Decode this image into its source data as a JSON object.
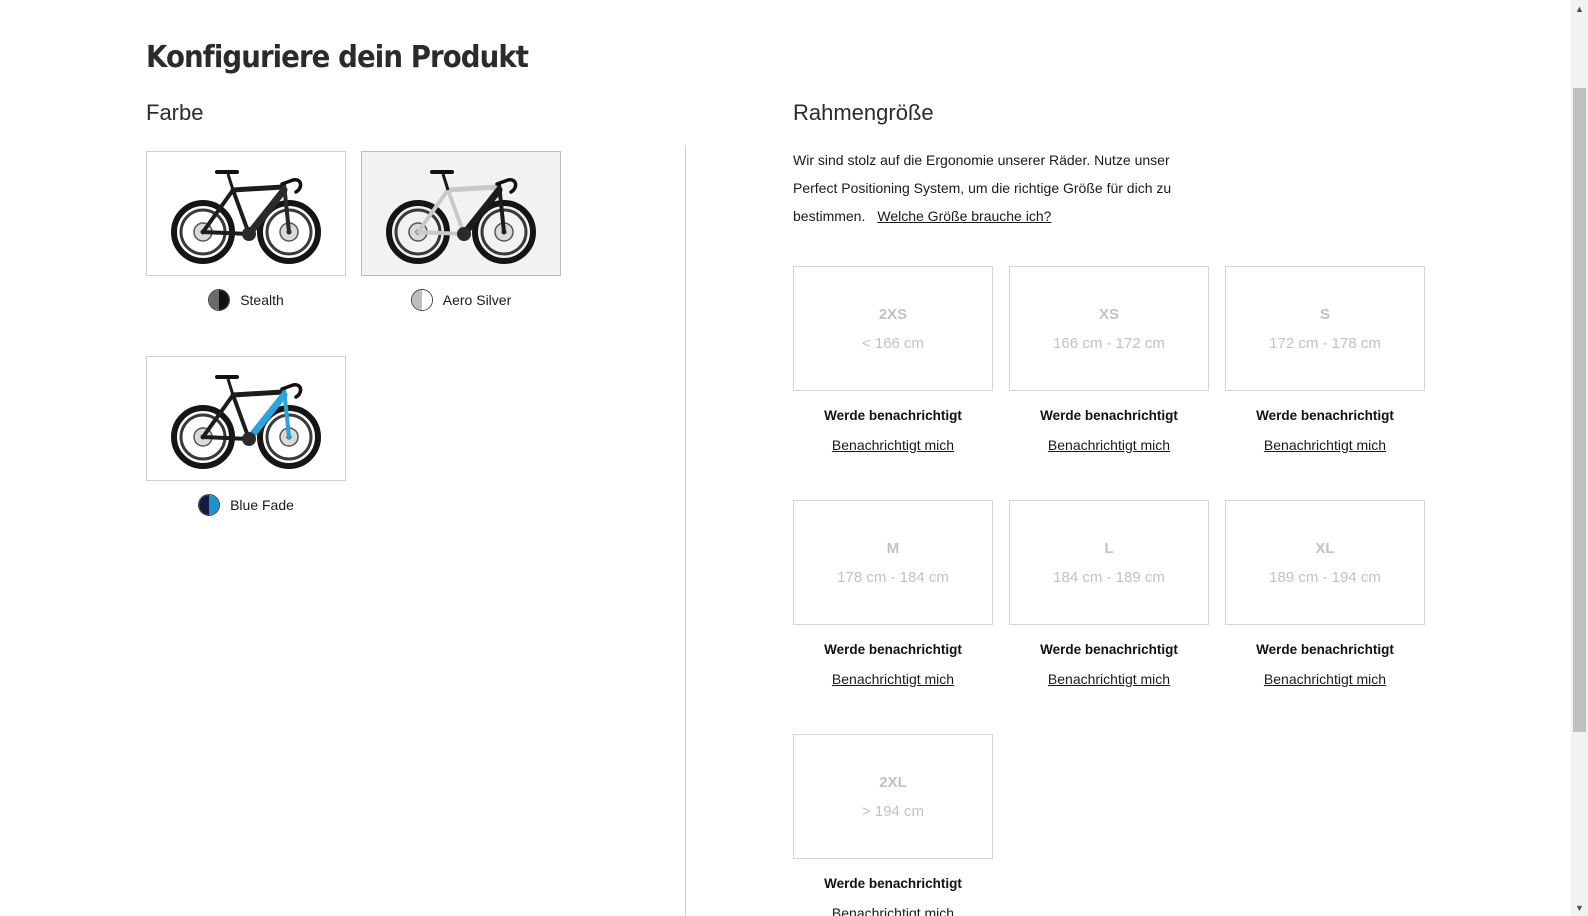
{
  "page": {
    "title": "Konfiguriere dein Produkt"
  },
  "color_section": {
    "heading": "Farbe",
    "options": [
      {
        "label": "Stealth",
        "selected": false,
        "swatch_colors": [
          "#6a6a6a",
          "#111111"
        ],
        "frame_color": "#1c1c1c",
        "accent_color": "#2a2a2a"
      },
      {
        "label": "Aero Silver",
        "selected": true,
        "swatch_colors": [
          "#bdbdbd",
          "#ffffff"
        ],
        "frame_color": "#c9c9c9",
        "accent_color": "#1c1c1c"
      },
      {
        "label": "Blue Fade",
        "selected": false,
        "swatch_colors": [
          "#0f1e3d",
          "#1f8fd1"
        ],
        "frame_color": "#1c1c1c",
        "accent_color": "#2aa4dc"
      }
    ]
  },
  "size_section": {
    "heading": "Rahmengröße",
    "intro_text": "Wir sind stolz auf die Ergonomie unserer Räder. Nutze unser Perfect Positioning System, um die richtige Größe für dich zu bestimmen.",
    "help_link": "Welche Größe brauche ich?",
    "sizes": [
      {
        "name": "2XS",
        "range": "< 166 cm",
        "notify_title": "Werde benachrichtigt",
        "notify_link": "Benachrichtigt mich"
      },
      {
        "name": "XS",
        "range": "166 cm - 172 cm",
        "notify_title": "Werde benachrichtigt",
        "notify_link": "Benachrichtigt mich"
      },
      {
        "name": "S",
        "range": "172 cm - 178 cm",
        "notify_title": "Werde benachrichtigt",
        "notify_link": "Benachrichtigt mich"
      },
      {
        "name": "M",
        "range": "178 cm - 184 cm",
        "notify_title": "Werde benachrichtigt",
        "notify_link": "Benachrichtigt mich"
      },
      {
        "name": "L",
        "range": "184 cm - 189 cm",
        "notify_title": "Werde benachrichtigt",
        "notify_link": "Benachrichtigt mich"
      },
      {
        "name": "XL",
        "range": "189 cm - 194 cm",
        "notify_title": "Werde benachrichtigt",
        "notify_link": "Benachrichtigt mich"
      },
      {
        "name": "2XL",
        "range": "> 194 cm",
        "notify_title": "Werde benachrichtigt",
        "notify_link": "Benachrichtigt mich"
      }
    ]
  },
  "scrollbar": {
    "up_icon": "chevron-up-icon",
    "down_icon": "chevron-down-icon"
  }
}
